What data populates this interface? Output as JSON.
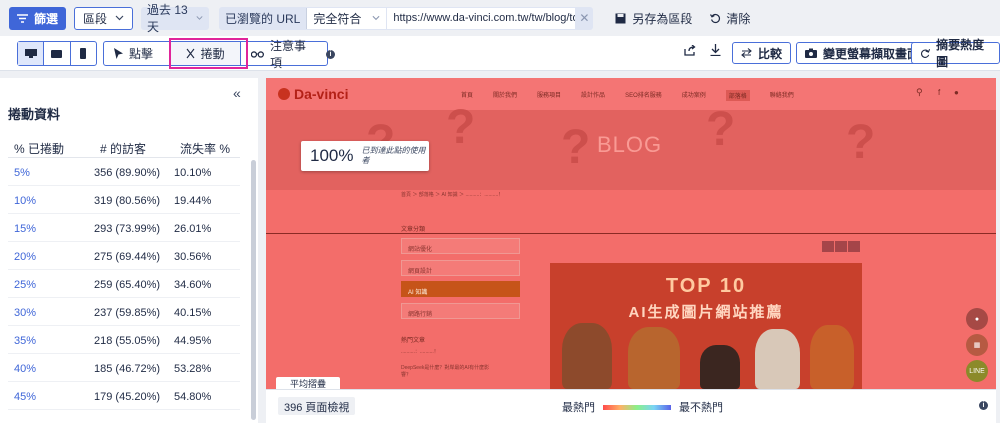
{
  "topbar": {
    "filter_label": "篩選",
    "segment_label": "區段",
    "date_label": "過去 13 天",
    "url_label": "已瀏覽的 URL",
    "match_value": "完全符合",
    "url_value": "https://www.da-vinci.com.tw/tw/blog/top1...",
    "save_label": "另存為區段",
    "clear_label": "清除"
  },
  "toolbar": {
    "click_label": "點擊",
    "scroll_label": "捲動",
    "notes_label": "注意事項",
    "compare_label": "比較",
    "screenshot_label": "變更螢幕擷取畫面",
    "summary_label": "摘要熱度圖"
  },
  "panel": {
    "title": "捲動資料",
    "headers": [
      "% 已捲動",
      "# 的訪客",
      "流失率 %"
    ],
    "rows": [
      {
        "pct": "5%",
        "visitors": "356 (89.90%)",
        "drop": "10.10%"
      },
      {
        "pct": "10%",
        "visitors": "319 (80.56%)",
        "drop": "19.44%"
      },
      {
        "pct": "15%",
        "visitors": "293 (73.99%)",
        "drop": "26.01%"
      },
      {
        "pct": "20%",
        "visitors": "275 (69.44%)",
        "drop": "30.56%"
      },
      {
        "pct": "25%",
        "visitors": "259 (65.40%)",
        "drop": "34.60%"
      },
      {
        "pct": "30%",
        "visitors": "237 (59.85%)",
        "drop": "40.15%"
      },
      {
        "pct": "35%",
        "visitors": "218 (55.05%)",
        "drop": "44.95%"
      },
      {
        "pct": "40%",
        "visitors": "185 (46.72%)",
        "drop": "53.28%"
      },
      {
        "pct": "45%",
        "visitors": "179 (45.20%)",
        "drop": "54.80%"
      }
    ]
  },
  "preview": {
    "logo": "Da-vinci",
    "nav": [
      "首頁",
      "關於我們",
      "服務項目",
      "設計作品",
      "SEO排名服務",
      "成功案例",
      "部落格",
      "聯絡我們"
    ],
    "banner": "BLOG",
    "breadcrumb": "首頁 ＞ 部落格 ＞ AI 知識 ＞ ..........：..........！",
    "side_heading": "文章分類",
    "categories": [
      "網站優化",
      "網頁設計",
      "AI 知識",
      "網路行銷"
    ],
    "hot_heading": "熱門文章",
    "hot_1": "..........：..........！",
    "hot_2": "DeepSeek是什麼？對岸最的AI有什麼影響？",
    "hero_title": "TOP 10",
    "hero_subtitle": "AI生成圖片網站推薦",
    "callout_pct": "100%",
    "callout_desc": "已到達此點的使用者",
    "footer_tab": "平均摺疊"
  },
  "bottombar": {
    "page_views": "396 頁面檢視",
    "hottest": "最熱門",
    "coldest": "最不熱門"
  }
}
